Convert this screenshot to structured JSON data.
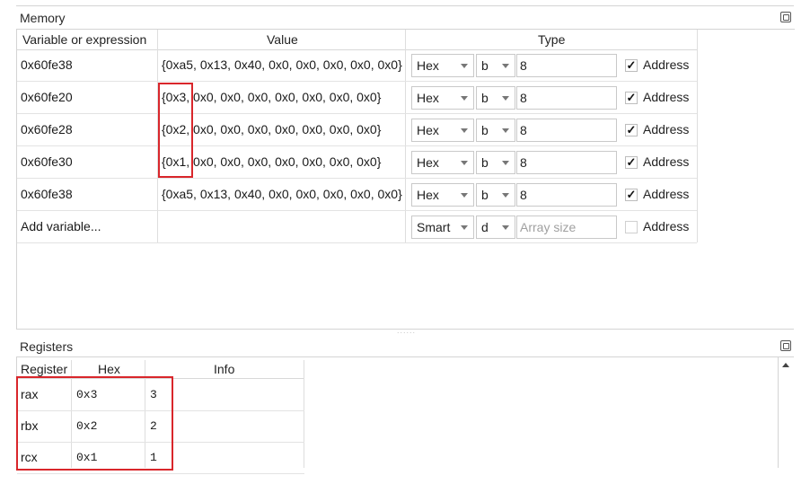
{
  "memory": {
    "title": "Memory",
    "columns": {
      "variable": "Variable or expression",
      "value": "Value",
      "type": "Type"
    },
    "rows": [
      {
        "expr": "0x60fe38",
        "value": "{0xa5, 0x13, 0x40, 0x0, 0x0, 0x0, 0x0, 0x0}",
        "format": "Hex",
        "unit": "b",
        "count": "8",
        "address_checked": true
      },
      {
        "expr": "0x60fe20",
        "value": "{0x3, 0x0, 0x0, 0x0, 0x0, 0x0, 0x0, 0x0}",
        "format": "Hex",
        "unit": "b",
        "count": "8",
        "address_checked": true
      },
      {
        "expr": "0x60fe28",
        "value": "{0x2, 0x0, 0x0, 0x0, 0x0, 0x0, 0x0, 0x0}",
        "format": "Hex",
        "unit": "b",
        "count": "8",
        "address_checked": true
      },
      {
        "expr": "0x60fe30",
        "value": "{0x1, 0x0, 0x0, 0x0, 0x0, 0x0, 0x0, 0x0}",
        "format": "Hex",
        "unit": "b",
        "count": "8",
        "address_checked": true
      },
      {
        "expr": "0x60fe38",
        "value": "{0xa5, 0x13, 0x40, 0x0, 0x0, 0x0, 0x0, 0x0}",
        "format": "Hex",
        "unit": "b",
        "count": "8",
        "address_checked": true
      }
    ],
    "add_row": {
      "label": "Add variable...",
      "format": "Smart",
      "unit": "d",
      "count_placeholder": "Array size",
      "address_checked": false
    },
    "address_label": "Address",
    "check_glyph": "✓"
  },
  "registers": {
    "title": "Registers",
    "columns": {
      "register": "Register",
      "hex": "Hex",
      "info": "Info"
    },
    "rows": [
      {
        "name": "rax",
        "hex": "0x3",
        "info": "3"
      },
      {
        "name": "rbx",
        "hex": "0x2",
        "info": "2"
      },
      {
        "name": "rcx",
        "hex": "0x1",
        "info": "1"
      }
    ]
  },
  "highlight_color": "#d9262b",
  "splitter_glyph": "......"
}
